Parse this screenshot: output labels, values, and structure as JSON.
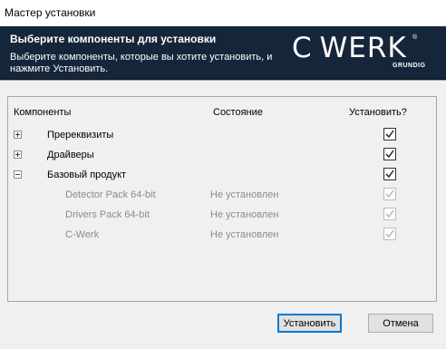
{
  "window": {
    "title": "Мастер установки"
  },
  "banner": {
    "heading": "Выберите компоненты для установки",
    "subtext": "Выберите компоненты, которые вы хотите установить, и нажмите Установить.",
    "logo_text": "C·WERK",
    "logo_reg": "®",
    "logo_brand": "GRUNDIG",
    "background_color": "#16263a"
  },
  "table": {
    "headers": {
      "components": "Компоненты",
      "status": "Состояние",
      "install": "Установить?"
    },
    "rows": [
      {
        "name": "Пререквизиты",
        "expander": "plus",
        "status": "",
        "checked": true,
        "enabled": true
      },
      {
        "name": "Драйверы",
        "expander": "plus",
        "status": "",
        "checked": true,
        "enabled": true
      },
      {
        "name": "Базовый продукт",
        "expander": "minus",
        "status": "",
        "checked": true,
        "enabled": true
      },
      {
        "name": "Detector Pack 64-bit",
        "expander": "",
        "status": "Не установлен",
        "checked": true,
        "enabled": false
      },
      {
        "name": "Drivers Pack 64-bit",
        "expander": "",
        "status": "Не установлен",
        "checked": true,
        "enabled": false
      },
      {
        "name": "C-Werk",
        "expander": "",
        "status": "Не установлен",
        "checked": true,
        "enabled": false
      }
    ]
  },
  "buttons": {
    "install": "Установить",
    "cancel": "Отмена"
  }
}
